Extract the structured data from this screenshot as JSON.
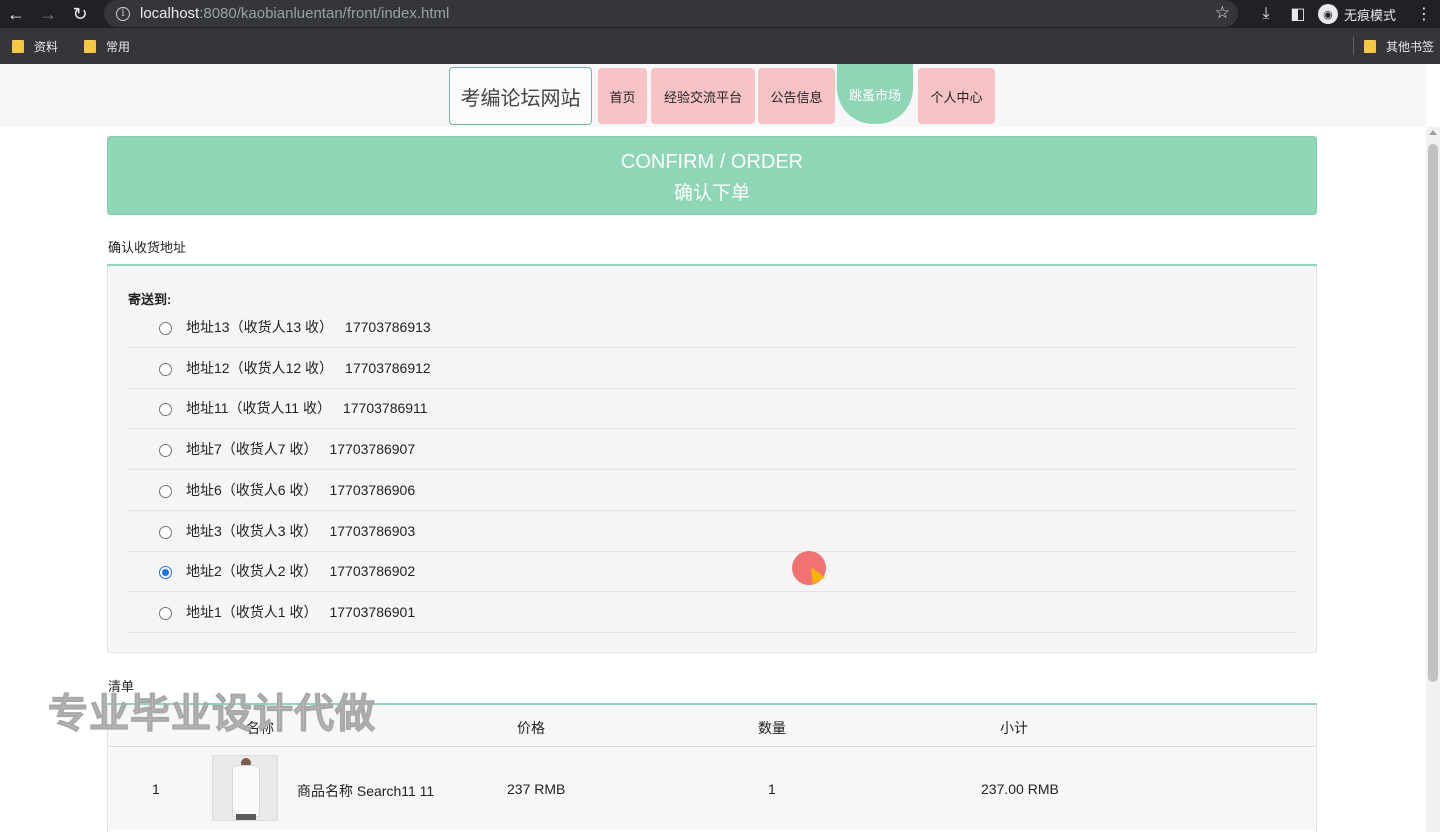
{
  "browser": {
    "url_host": "localhost",
    "url_path": ":8080/kaobianluentan/front/index.html",
    "incognito_label": "无痕模式",
    "bookmarks": [
      "资料",
      "常用"
    ],
    "other_bookmarks": "其他书签",
    "icons": [
      "back-icon",
      "forward-icon",
      "reload-icon",
      "info-icon",
      "star-icon",
      "download-icon",
      "sidepanel-icon",
      "incognito-icon",
      "menu-icon"
    ]
  },
  "nav": {
    "brand": "考编论坛网站",
    "items": [
      "首页",
      "经验交流平台",
      "公告信息",
      "跳蚤市场",
      "个人中心"
    ],
    "active_index": 3
  },
  "banner": {
    "title_en": "CONFIRM / ORDER",
    "title_cn": "确认下单"
  },
  "address_section": {
    "label": "确认收货地址",
    "send_to": "寄送到:",
    "addresses": [
      {
        "name": "地址13",
        "receiver": "（收货人13 收）",
        "phone": "17703786913",
        "checked": false
      },
      {
        "name": "地址12",
        "receiver": "（收货人12 收）",
        "phone": "17703786912",
        "checked": false
      },
      {
        "name": "地址11",
        "receiver": "（收货人11 收）",
        "phone": "17703786911",
        "checked": false
      },
      {
        "name": "地址7",
        "receiver": "（收货人7 收）",
        "phone": "17703786907",
        "checked": false
      },
      {
        "name": "地址6",
        "receiver": "（收货人6 收）",
        "phone": "17703786906",
        "checked": false
      },
      {
        "name": "地址3",
        "receiver": "（收货人3 收）",
        "phone": "17703786903",
        "checked": false
      },
      {
        "name": "地址2",
        "receiver": "（收货人2 收）",
        "phone": "17703786902",
        "checked": true
      },
      {
        "name": "地址1",
        "receiver": "（收货人1 收）",
        "phone": "17703786901",
        "checked": false
      }
    ]
  },
  "cart": {
    "label": "清单",
    "headers": [
      "名称",
      "价格",
      "数量",
      "小计"
    ],
    "rows": [
      {
        "index": "1",
        "name": "商品名称 Search11 11",
        "price": "237 RMB",
        "qty": "1",
        "subtotal": "237.00 RMB"
      }
    ]
  },
  "watermark": "专业毕业设计代做",
  "colors": {
    "accent": "#8fd6b7",
    "nav_pink": "#f5c3c5",
    "radio_blue": "#1a73e8"
  }
}
